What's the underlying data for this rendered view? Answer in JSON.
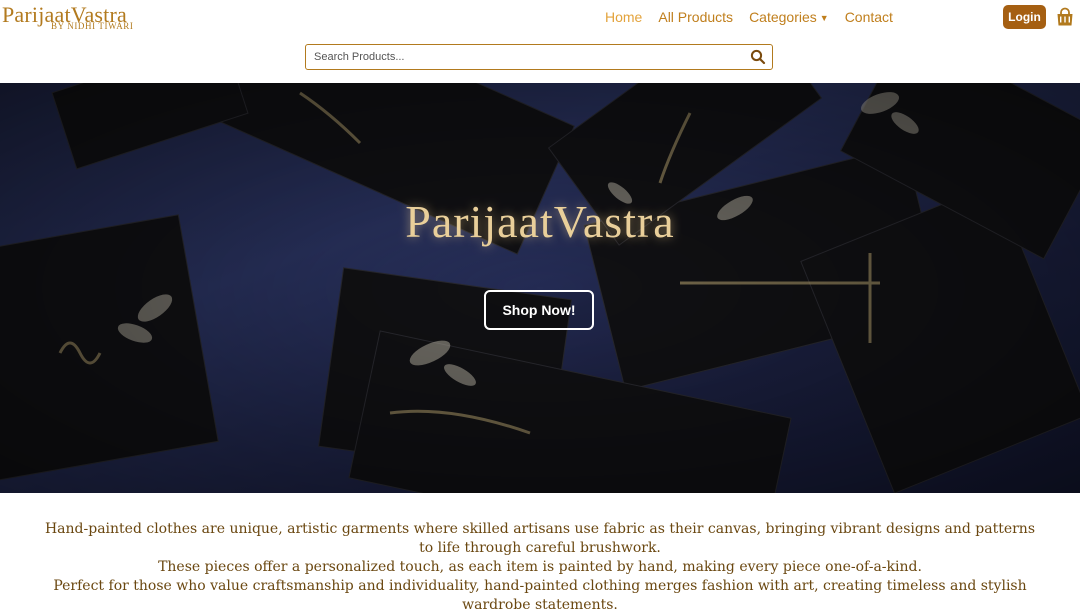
{
  "header": {
    "logo_main": "ParijaatVastra",
    "logo_sub": "BY NIDHI TIWARI",
    "nav": [
      {
        "label": "Home",
        "active": true
      },
      {
        "label": "All Products",
        "active": false
      },
      {
        "label": "Categories",
        "active": false
      },
      {
        "label": "Contact",
        "active": false
      }
    ],
    "login_label": "Login",
    "cart_icon": "shopping-bag-icon",
    "search": {
      "placeholder": "Search Products...",
      "value": "",
      "icon": "search-icon"
    }
  },
  "hero": {
    "title": "ParijaatVastra",
    "cta_label": "Shop Now!"
  },
  "description": {
    "lines": [
      "Hand-painted clothes are unique, artistic garments where skilled artisans use fabric as their canvas, bringing vibrant designs and patterns to life through careful brushwork.",
      "These pieces offer a personalized touch, as each item is painted by hand, making every piece one-of-a-kind.",
      "Perfect for those who value craftsmanship and individuality, hand-painted clothing merges fashion with art, creating timeless and stylish wardrobe statements."
    ]
  },
  "colors": {
    "brand": "#b27a1e",
    "nav_active": "#e3a33c",
    "login_bg": "#a55f12",
    "hero_gold": "#e9cf9a",
    "text_brown": "#6a4710"
  }
}
